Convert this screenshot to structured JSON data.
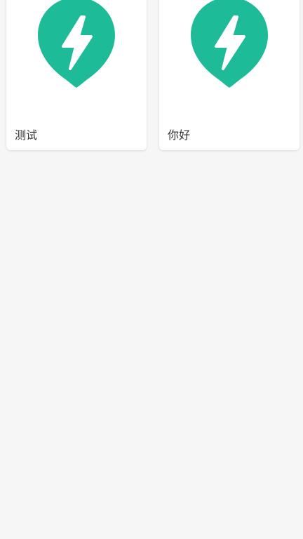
{
  "colors": {
    "background": "#f6f6f6",
    "card": "#ffffff",
    "icon_pin": "#1dbb98",
    "label_text": "#333333"
  },
  "cards": [
    {
      "label": "测试",
      "icon": "lightning-pin-icon"
    },
    {
      "label": "你好",
      "icon": "lightning-pin-icon"
    }
  ]
}
